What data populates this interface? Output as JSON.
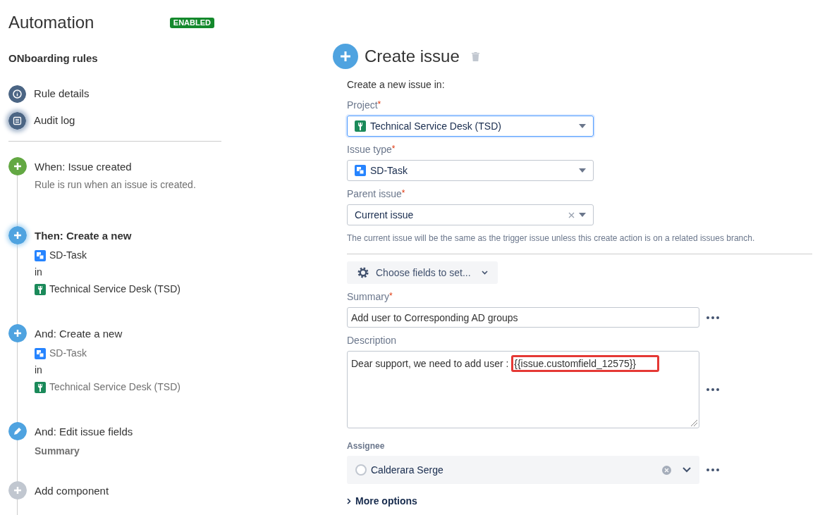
{
  "header": {
    "title": "Automation",
    "status": "ENABLED"
  },
  "rule_name": "ONboarding rules",
  "nav": [
    {
      "label": "Rule details",
      "kind": "info",
      "selected": false
    },
    {
      "label": "Audit log",
      "kind": "log",
      "selected": true
    }
  ],
  "steps": [
    {
      "kind": "trigger",
      "title": "When: Issue created",
      "selected": false,
      "note": "Rule is run when an issue is created."
    },
    {
      "kind": "create",
      "title": "Then: Create a new",
      "selected": true,
      "issue_type": "SD-Task",
      "joiner": "in",
      "project": "Technical Service Desk (TSD)"
    },
    {
      "kind": "create",
      "title": "And: Create a new",
      "selected": false,
      "issue_type": "SD-Task",
      "joiner": "in",
      "project": "Technical Service Desk (TSD)"
    },
    {
      "kind": "edit",
      "title": "And: Edit issue fields",
      "selected": false,
      "field": "Summary"
    },
    {
      "kind": "add",
      "title": "Add component",
      "selected": false
    }
  ],
  "panel": {
    "title": "Create issue",
    "intro": "Create a new issue in:",
    "project": {
      "label": "Project",
      "required_mark": "*",
      "value": "Technical Service Desk (TSD)",
      "focused": true
    },
    "issue_type": {
      "label": "Issue type",
      "required_mark": "*",
      "value": "SD-Task"
    },
    "parent": {
      "label": "Parent issue",
      "required_mark": "*",
      "value": "Current issue",
      "help": "The current issue will be the same as the trigger issue unless this create action is on a related issues branch."
    },
    "choose_fields": "Choose fields to set...",
    "summary": {
      "label": "Summary",
      "required_mark": "*",
      "value": "Add user to Corresponding AD groups"
    },
    "description": {
      "label": "Description",
      "value": "Dear support, we need to add user : ",
      "highlighted": "{{issue.customfield_12575}}"
    },
    "assignee": {
      "label": "Assignee",
      "value": "Calderara Serge"
    },
    "more_options": "More options"
  }
}
